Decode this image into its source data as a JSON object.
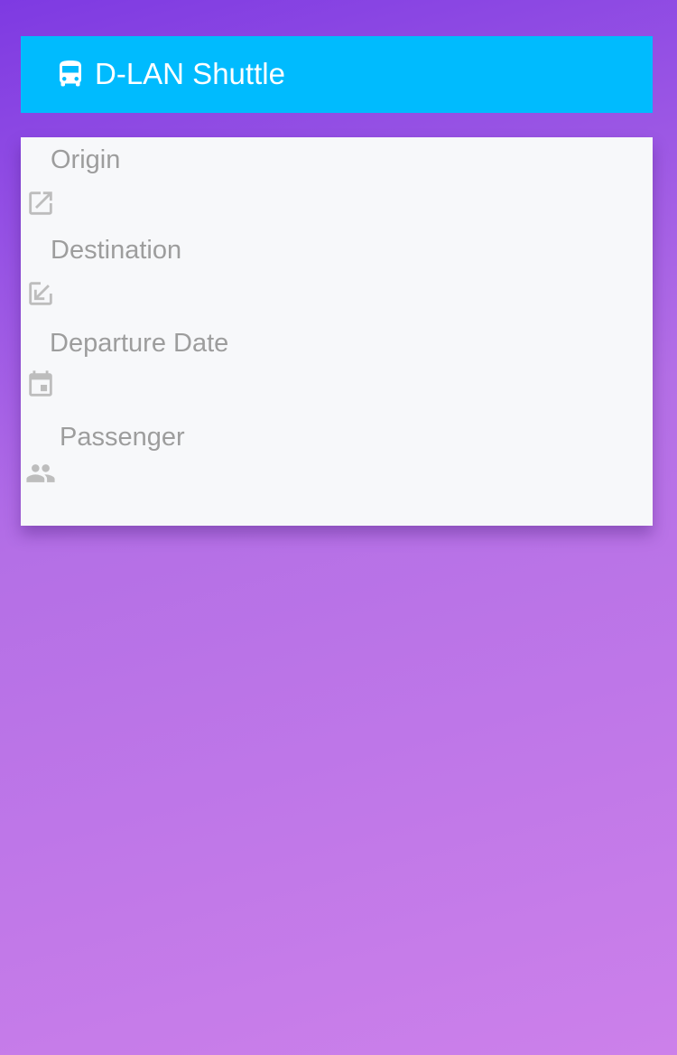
{
  "header": {
    "title": "D-LAN Shuttle",
    "icon": "bus-icon",
    "background_color": "#00bbfe"
  },
  "form": {
    "fields": [
      {
        "label": "Origin",
        "icon": "open-in-new-icon"
      },
      {
        "label": "Destination",
        "icon": "call-received-icon"
      },
      {
        "label": "Departure Date",
        "icon": "calendar-icon"
      },
      {
        "label": "Passenger",
        "icon": "people-icon"
      }
    ]
  },
  "colors": {
    "background_top": "#7e3ae2",
    "background_bottom": "#cc80ea",
    "card": "#f7f8fa",
    "label_text": "#9d9d9d",
    "icon": "#bdbdbd"
  }
}
